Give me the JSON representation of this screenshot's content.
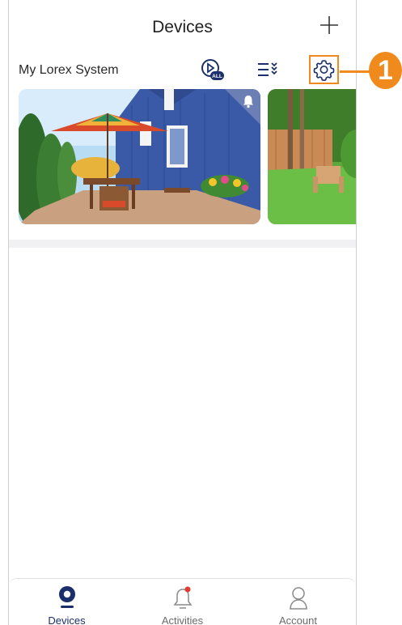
{
  "header": {
    "title": "Devices",
    "add_icon": "plus-icon"
  },
  "system": {
    "name": "My Lorex System",
    "icons": [
      "play-all-icon",
      "list-filter-icon",
      "gear-icon"
    ]
  },
  "cameras": [
    {
      "alert_icon": "bell-icon",
      "thumbnail": "patio-umbrella-blue-house"
    },
    {
      "thumbnail": "garden-adirondack-chairs"
    }
  ],
  "play_all_badge": "ALL",
  "tabs": [
    {
      "label": "Devices",
      "icon": "camera-icon",
      "active": true
    },
    {
      "label": "Activities",
      "icon": "bell-icon",
      "notification_dot": true
    },
    {
      "label": "Account",
      "icon": "person-icon"
    }
  ],
  "callout": {
    "number": "1"
  },
  "colors": {
    "accent": "#f08a1d",
    "brand_navy": "#1b2f6b",
    "notif_red": "#e53935"
  }
}
